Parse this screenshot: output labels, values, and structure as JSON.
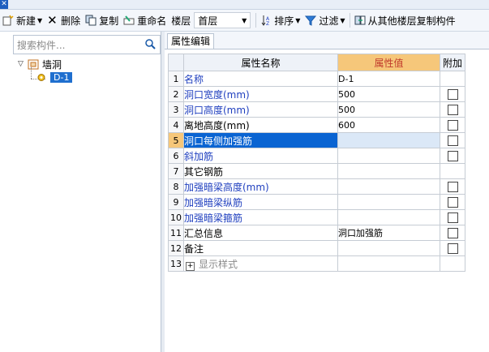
{
  "toolbar": {
    "new_label": "新建",
    "delete_label": "删除",
    "copy_label": "复制",
    "rename_label": "重命名",
    "floor_label": "楼层",
    "floor_value": "首层",
    "sort_label": "排序",
    "filter_label": "过滤",
    "copy_from_floor_label": "从其他楼层复制构件"
  },
  "sidebar": {
    "search_placeholder": "搜索构件...",
    "tree": {
      "root_label": "墙洞",
      "child_label": "D-1"
    }
  },
  "main": {
    "tab_label": "属性编辑",
    "columns": {
      "name": "属性名称",
      "value": "属性值",
      "add": "附加"
    },
    "rows": [
      {
        "num": "1",
        "name": "名称",
        "value": "D-1",
        "checkbox": false
      },
      {
        "num": "2",
        "name": "洞口宽度(mm)",
        "value": "500",
        "checkbox": true
      },
      {
        "num": "3",
        "name": "洞口高度(mm)",
        "value": "500",
        "checkbox": true
      },
      {
        "num": "4",
        "name": "离地高度(mm)",
        "value": "600",
        "checkbox": true
      },
      {
        "num": "5",
        "name": "洞口每侧加强筋",
        "value": "",
        "checkbox": true
      },
      {
        "num": "6",
        "name": "斜加筋",
        "value": "",
        "checkbox": true
      },
      {
        "num": "7",
        "name": "其它钢筋",
        "value": "",
        "checkbox": false
      },
      {
        "num": "8",
        "name": "加强暗梁高度(mm)",
        "value": "",
        "checkbox": true
      },
      {
        "num": "9",
        "name": "加强暗梁纵筋",
        "value": "",
        "checkbox": true
      },
      {
        "num": "10",
        "name": "加强暗梁箍筋",
        "value": "",
        "checkbox": true
      },
      {
        "num": "11",
        "name": "汇总信息",
        "value": "洞口加强筋",
        "checkbox": true
      },
      {
        "num": "12",
        "name": "备注",
        "value": "",
        "checkbox": true
      },
      {
        "num": "13",
        "name": "显示样式",
        "value": "",
        "checkbox": false
      }
    ]
  },
  "colors": {
    "selected_row": "#0a64d2",
    "value_header": "#f6c77a",
    "property_blue": "#1f3fbf"
  }
}
